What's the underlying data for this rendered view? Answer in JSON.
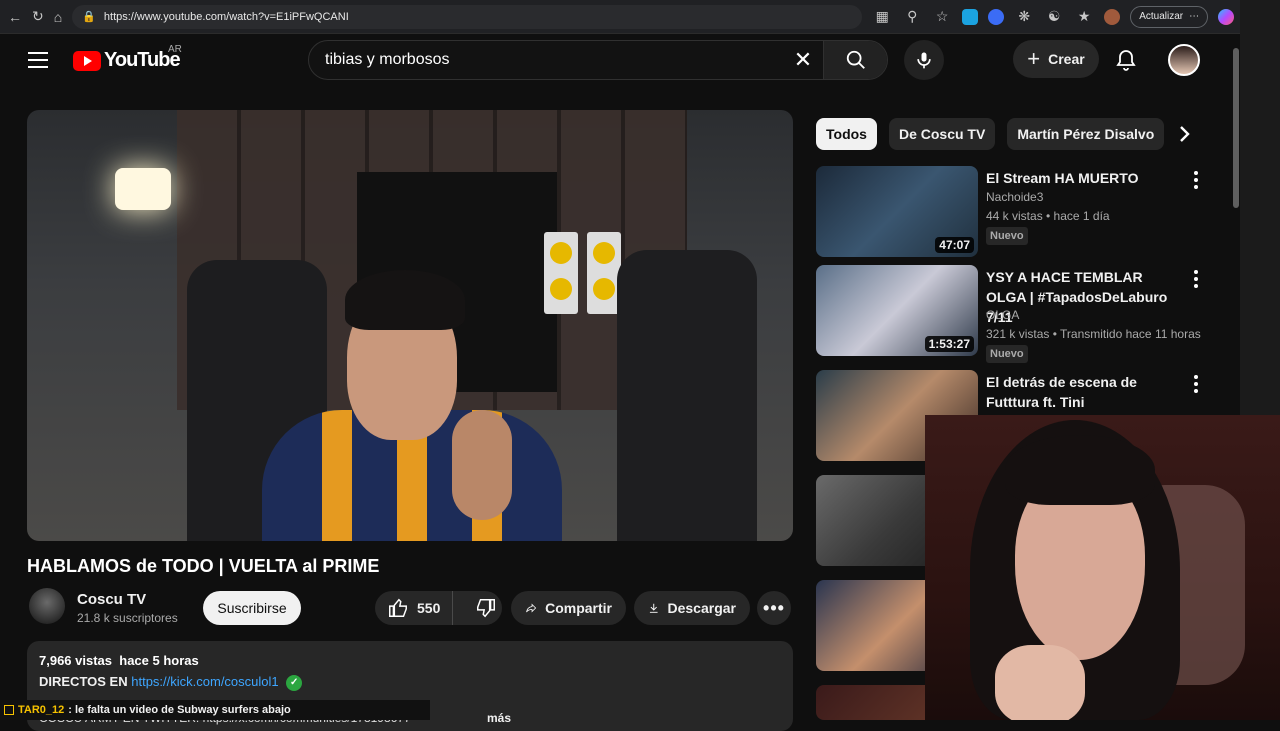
{
  "browser": {
    "url": "https://www.youtube.com/watch?v=E1iPFwQCANI",
    "update_label": "Actualizar"
  },
  "header": {
    "logo_text": "YouTube",
    "country_code": "AR",
    "search_value": "tibias y morbosos",
    "create_label": "Crear"
  },
  "video": {
    "title": "HABLAMOS de TODO | VUELTA al PRIME",
    "channel_name": "Coscu TV",
    "subscribers": "21.8 k suscriptores",
    "subscribe_label": "Suscribirse",
    "likes": "550",
    "share_label": "Compartir",
    "download_label": "Descargar"
  },
  "description": {
    "views": "7,966 vistas",
    "time": "hace 5 horas",
    "line2_prefix": "DIRECTOS EN",
    "line2_link": "https://kick.com/cosculol1",
    "line3": "COSCU ARMY EN TWITTER: https://x.com/i/communities/178198677",
    "more_label": "más"
  },
  "chat": {
    "user": "TAR0_12",
    "message": ": le falta un video de Subway surfers abajo"
  },
  "chips": [
    "Todos",
    "De Coscu TV",
    "Martín Pérez Disalvo"
  ],
  "recommendations": [
    {
      "title": "El Stream HA MUERTO",
      "channel": "Nachoide3",
      "meta": "44 k vistas • hace 1 día",
      "badge": "Nuevo",
      "duration": "47:07"
    },
    {
      "title": "YSY A HACE TEMBLAR OLGA | #TapadosDeLaburo 7/11",
      "channel": "OLGA",
      "meta": "321 k vistas • Transmitido hace 11 horas",
      "badge": "Nuevo",
      "duration": "1:53:27"
    },
    {
      "title": "El detrás de escena de Futttura ft. Tini"
    }
  ],
  "colors": {
    "background": "#0f0f0f",
    "accent_red": "#ff0000",
    "link_blue": "#3ea6ff",
    "verified_green": "#2ba640"
  }
}
